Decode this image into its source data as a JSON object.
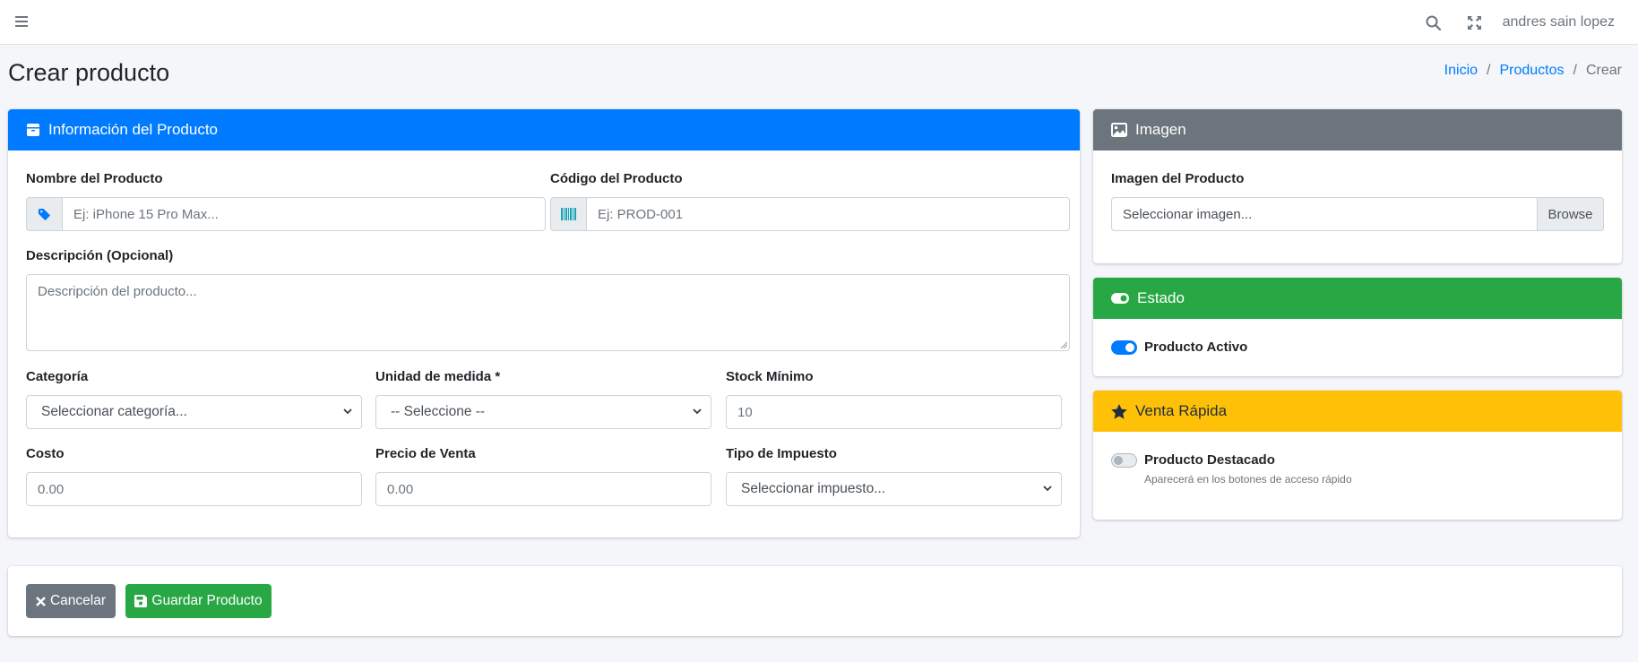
{
  "navbar": {
    "menu_icon": "bars-icon",
    "search_icon": "search-icon",
    "fullscreen_icon": "expand-icon",
    "user_name": "andres sain lopez"
  },
  "page": {
    "title": "Crear producto",
    "breadcrumb": [
      "Inicio",
      "Productos",
      "Crear"
    ],
    "breadcrumb_sep": "/"
  },
  "info_card": {
    "title": "Información del Producto",
    "color": "#007bff",
    "name_label": "Nombre del Producto",
    "name_placeholder": "Ej: iPhone 15 Pro Max...",
    "code_label": "Código del Producto",
    "code_placeholder": "Ej: PROD-001",
    "desc_label": "Descripción (Opcional)",
    "desc_placeholder": "Descripción del producto...",
    "category_label": "Categoría",
    "category_value": "Seleccionar categoría...",
    "unit_label": "Unidad de medida *",
    "unit_value": "-- Seleccione --",
    "stock_label": "Stock Mínimo",
    "stock_placeholder": "10",
    "cost_label": "Costo",
    "cost_placeholder": "0.00",
    "price_label": "Precio de Venta",
    "price_placeholder": "0.00",
    "tax_label": "Tipo de Impuesto",
    "tax_value": "Seleccionar impuesto..."
  },
  "image_card": {
    "title": "Imagen",
    "color": "#6c757d",
    "label": "Imagen del Producto",
    "file_placeholder": "Seleccionar imagen...",
    "browse_label": "Browse"
  },
  "status_card": {
    "title": "Estado",
    "color": "#28a745",
    "toggle_label": "Producto Activo",
    "toggle_on": true
  },
  "quick_card": {
    "title": "Venta Rápida",
    "color": "#ffc107",
    "toggle_label": "Producto Destacado",
    "toggle_on": false,
    "help": "Aparecerá en los botones de acceso rápido"
  },
  "actions": {
    "cancel_label": "Cancelar",
    "save_label": "Guardar Producto"
  }
}
